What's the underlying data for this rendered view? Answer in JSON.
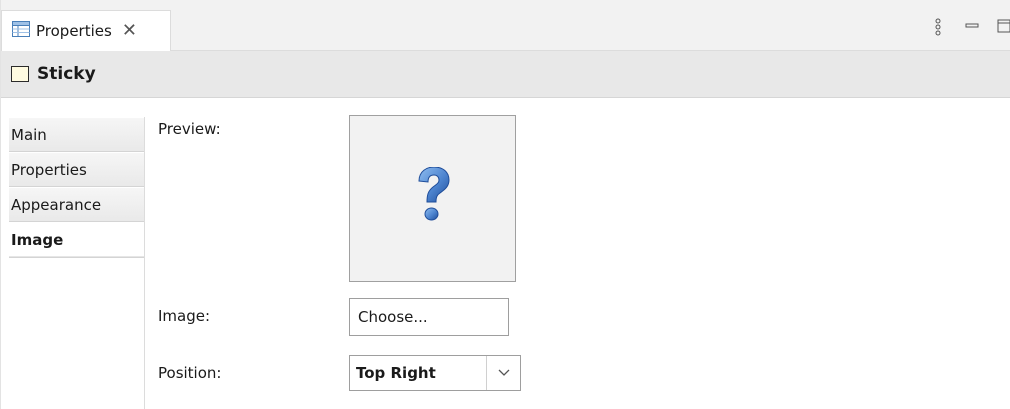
{
  "view_tab": {
    "label": "Properties",
    "close_symbol": "✕"
  },
  "header": {
    "title": "Sticky",
    "icon": "sticky-note-icon"
  },
  "side_tabs": [
    {
      "label": "Main",
      "active": false
    },
    {
      "label": "Properties",
      "active": false
    },
    {
      "label": "Appearance",
      "active": false
    },
    {
      "label": "Image",
      "active": true
    }
  ],
  "image_section": {
    "preview_label": "Preview:",
    "preview_icon": "question-mark-icon",
    "image_label": "Image:",
    "choose_label": "Choose...",
    "position_label": "Position:",
    "position_value": "Top Right"
  },
  "toolbar_icons": [
    "view-menu-icon",
    "minimize-icon",
    "maximize-icon"
  ],
  "colors": {
    "question_mark_light": "#6b9fd8",
    "question_mark_dark": "#1f4d9a",
    "header_bg": "#e8e8e8",
    "sticky_fill": "#fffbe1"
  }
}
